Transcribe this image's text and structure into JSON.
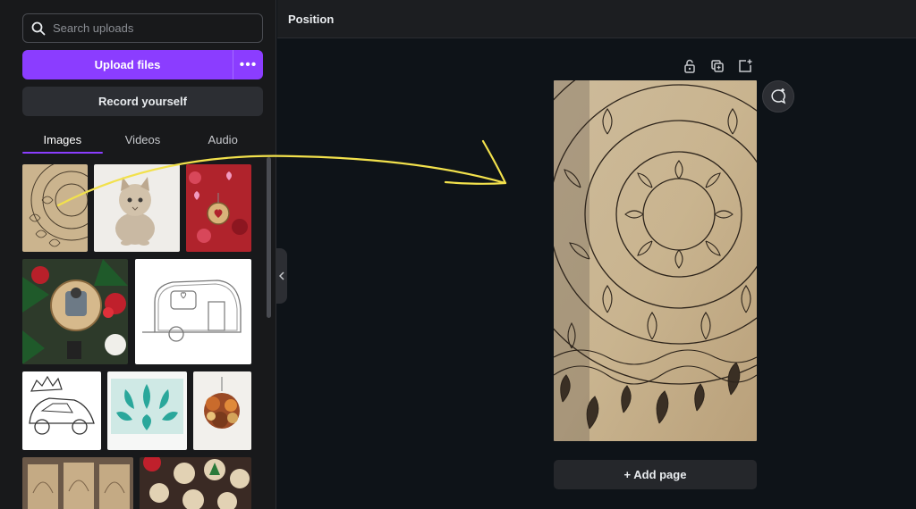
{
  "sidebar": {
    "search": {
      "placeholder": "Search uploads"
    },
    "upload_label": "Upload files",
    "more_label": "•••",
    "record_label": "Record yourself",
    "tabs": [
      {
        "label": "Images",
        "active": true
      },
      {
        "label": "Videos",
        "active": false
      },
      {
        "label": "Audio",
        "active": false
      }
    ]
  },
  "topbar": {
    "position_label": "Position"
  },
  "canvas": {
    "add_page_label": "+ Add page"
  },
  "colors": {
    "accent": "#8b3dff",
    "annotation": "#f2e14c"
  }
}
